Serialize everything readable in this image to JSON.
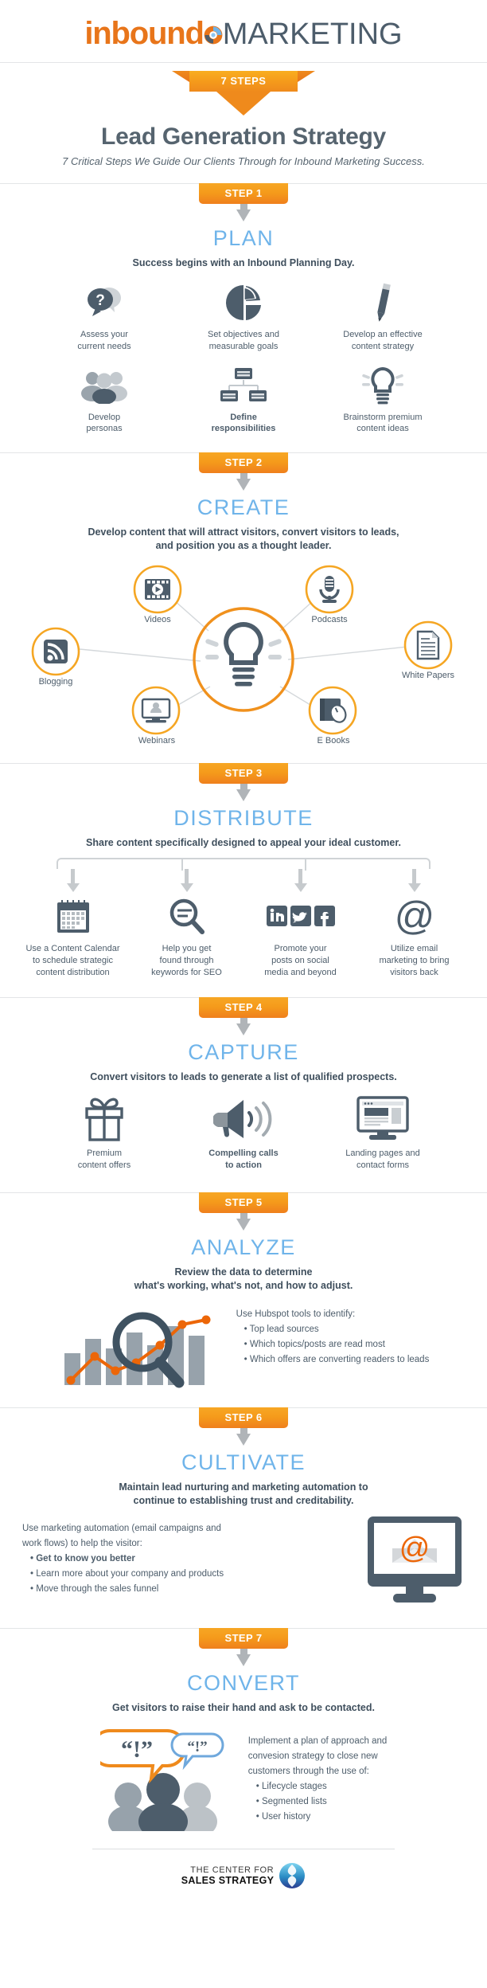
{
  "header": {
    "logo_part1": "inbound",
    "logo_part2": "MARKETING",
    "logo_icon": "globe-refresh-icon"
  },
  "hero": {
    "badge": "7 STEPS",
    "title": "Lead Generation Strategy",
    "subtitle": "7 Critical Steps We Guide Our Clients Through for Inbound Marketing Success."
  },
  "steps": [
    {
      "banner": "STEP 1",
      "title": "PLAN",
      "desc": "Success begins with an Inbound Planning Day.",
      "items": [
        {
          "icon": "question-speech-bubble-icon",
          "caption": "Assess your\ncurrent needs"
        },
        {
          "icon": "pie-chart-icon",
          "caption": "Set objectives and\nmeasurable goals"
        },
        {
          "icon": "pencil-icon",
          "caption": "Develop an effective\ncontent strategy"
        },
        {
          "icon": "people-group-icon",
          "caption": "Develop\npersonas"
        },
        {
          "icon": "org-chart-icon",
          "caption": "Define\nresponsibilities"
        },
        {
          "icon": "lightbulb-icon",
          "caption": "Brainstorm premium\ncontent ideas"
        }
      ]
    },
    {
      "banner": "STEP 2",
      "title": "CREATE",
      "desc": "Develop content that will attract visitors, convert visitors to leads,\nand position you as a thought leader.",
      "hub_icon": "lightbulb-icon",
      "nodes": [
        {
          "icon": "film-play-icon",
          "label": "Videos"
        },
        {
          "icon": "microphone-icon",
          "label": "Podcasts"
        },
        {
          "icon": "document-lines-icon",
          "label": "White Papers"
        },
        {
          "icon": "rss-feed-icon",
          "label": "Blogging"
        },
        {
          "icon": "monitor-person-icon",
          "label": "Webinars"
        },
        {
          "icon": "book-mouse-icon",
          "label": "E Books"
        }
      ]
    },
    {
      "banner": "STEP 3",
      "title": "DISTRIBUTE",
      "desc": "Share content specifically designed to appeal your ideal customer.",
      "items": [
        {
          "icon": "calendar-icon",
          "caption": "Use a Content Calendar\nto schedule strategic\ncontent distribution"
        },
        {
          "icon": "magnifier-seo-icon",
          "caption": "Help you get\nfound through\nkeywords for SEO"
        },
        {
          "icon": "social-media-icons",
          "caption": "Promote your\nposts on social\nmedia and beyond"
        },
        {
          "icon": "at-sign-email-icon",
          "caption": "Utilize email\nmarketing to bring\nvisitors back"
        }
      ]
    },
    {
      "banner": "STEP 4",
      "title": "CAPTURE",
      "desc": "Convert visitors to leads to generate a list of qualified prospects.",
      "items": [
        {
          "icon": "gift-box-icon",
          "caption": "Premium\ncontent offers"
        },
        {
          "icon": "megaphone-icon",
          "caption": "Compelling calls\nto action"
        },
        {
          "icon": "landing-page-monitor-icon",
          "caption": "Landing pages and\ncontact forms"
        }
      ]
    },
    {
      "banner": "STEP 5",
      "title": "ANALYZE",
      "desc": "Review the data to determine\nwhat's working, what's not, and how to adjust.",
      "art_icon": "bar-chart-magnifier-icon",
      "body_intro": "Use Hubspot tools to identify:",
      "bullets": [
        "Top lead sources",
        "Which topics/posts are read most",
        "Which offers are converting readers to leads"
      ]
    },
    {
      "banner": "STEP 6",
      "title": "CULTIVATE",
      "desc": "Maintain lead nurturing and marketing automation to\ncontinue to establishing trust and creditability.",
      "art_icon": "monitor-email-icon",
      "body_intro": "Use marketing automation (email campaigns and\nwork flows) to help the visitor:",
      "bullets": [
        "Get to know you better",
        "Learn more about your company and products",
        "Move through the sales funnel"
      ]
    },
    {
      "banner": "STEP 7",
      "title": "CONVERT",
      "desc": "Get visitors to raise their hand and ask to be contacted.",
      "art_icon": "people-speech-bubbles-icon",
      "body_intro": "Implement a plan of approach and\nconvesion strategy to close new\ncustomers through the use of:",
      "bullets": [
        "Lifecycle stages",
        "Segmented lists",
        "User history"
      ]
    }
  ],
  "footer": {
    "line1": "THE CENTER FOR",
    "line2": "SALES STRATEGY",
    "logo_icon": "csl-sphere-logo-icon"
  },
  "colors": {
    "orange": "#ef8a1c",
    "orange_dark": "#e8751a",
    "slate": "#4d5d6b",
    "blue_heading": "#6fb4ea",
    "gray_light": "#b9c0c5"
  }
}
